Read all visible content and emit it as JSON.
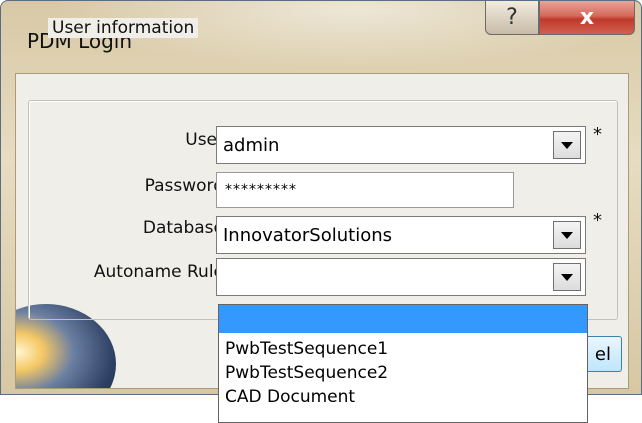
{
  "window": {
    "title": "PDM Login",
    "help_glyph": "?",
    "close_glyph": "x"
  },
  "group": {
    "legend": "User information"
  },
  "fields": {
    "user": {
      "label": "User",
      "value": "admin",
      "required": "*"
    },
    "password": {
      "label": "Password",
      "value": "*********"
    },
    "database": {
      "label": "Database",
      "value": "InnovatorSolutions",
      "required": "*"
    },
    "autoname": {
      "label": "Autoname Rule",
      "value": ""
    }
  },
  "dropdown": {
    "options": [
      "",
      "PwbTestSequence1",
      "PwbTestSequence2",
      "CAD Document"
    ],
    "selected_index": 0
  },
  "buttons": {
    "cancel_partial": "el"
  },
  "colors": {
    "selection": "#3399ff",
    "close_button": "#c0392b"
  }
}
